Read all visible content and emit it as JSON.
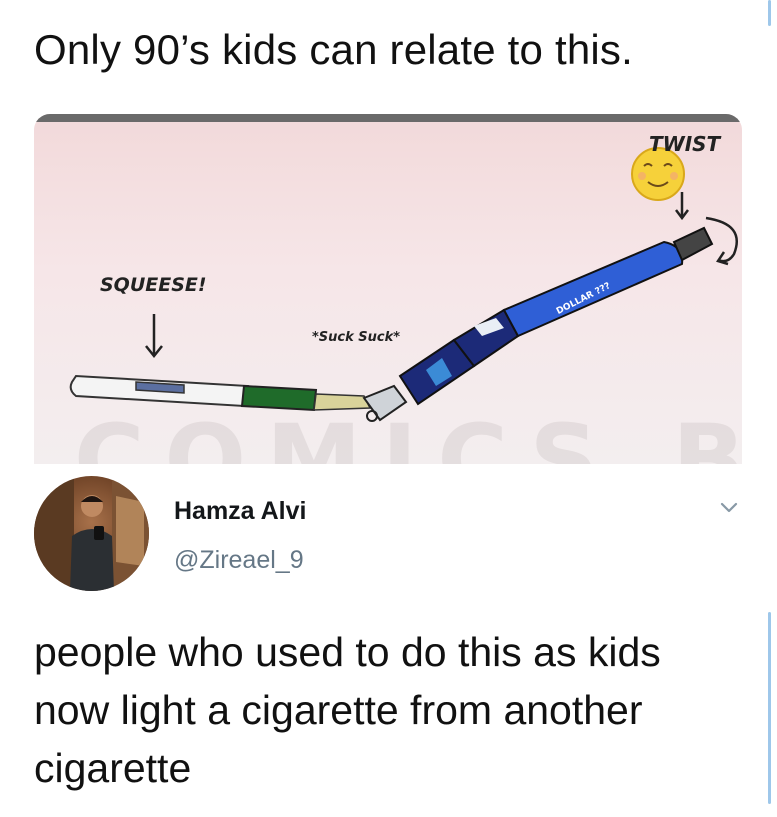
{
  "post": {
    "header_text": "Only 90’s kids can relate to this."
  },
  "comic": {
    "label_twist": "TWIST",
    "label_squeese": "SQUEESE!",
    "label_suck": "*Suck Suck*",
    "label_brand": "DOLLAR ???",
    "watermark": "COMICS BY"
  },
  "tweet": {
    "author_name": "Hamza Alvi",
    "author_handle": "@Zireael_9",
    "text": "people who used to do this as kids now light a cigarette from another cigarette",
    "menu_icon": "chevron-down-icon"
  },
  "colors": {
    "name": "#14171a",
    "handle": "#657786",
    "pen_blue": "#2f5fd6",
    "pen_navy": "#1c2a78",
    "refill_green": "#1f6b2a",
    "scroll_indicator": "#9ec7ea"
  }
}
